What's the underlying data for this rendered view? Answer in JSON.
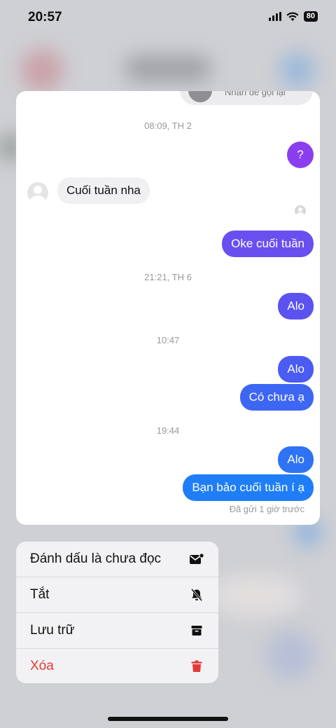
{
  "status_bar": {
    "time": "20:57",
    "battery": "80"
  },
  "conversation": {
    "top_pill_text": "Nhấn để gọi lại",
    "messages": [
      {
        "kind": "timestamp",
        "text": "08:09, TH 2"
      },
      {
        "kind": "sent",
        "text": "?",
        "color": "#8b3ef0"
      },
      {
        "kind": "received",
        "text": "Cuối tuần nha"
      },
      {
        "kind": "sent",
        "text": "Oke cuối tuần",
        "color": "#6a4ff0"
      },
      {
        "kind": "timestamp",
        "text": "21:21, TH 6"
      },
      {
        "kind": "sent",
        "text": "Alo",
        "color": "#5b52f0"
      },
      {
        "kind": "timestamp",
        "text": "10:47"
      },
      {
        "kind": "sent",
        "text": "Alo",
        "color": "#4a5cf2"
      },
      {
        "kind": "sent",
        "text": "Có chưa ạ",
        "color": "#3d66f3"
      },
      {
        "kind": "timestamp",
        "text": "19:44"
      },
      {
        "kind": "sent",
        "text": "Alo",
        "color": "#2f73f5"
      },
      {
        "kind": "sent",
        "text": "Bạn bảo cuối tuần í ạ",
        "color": "#1f7ef7"
      }
    ],
    "sent_status": "Đã gửi 1 giờ trước"
  },
  "context_menu": {
    "items": [
      {
        "label": "Đánh dấu là chưa đọc",
        "icon": "mark-unread-icon"
      },
      {
        "label": "Tắt",
        "icon": "mute-bell-icon"
      },
      {
        "label": "Lưu trữ",
        "icon": "archive-icon"
      },
      {
        "label": "Xóa",
        "icon": "trash-icon",
        "color": "#e53935"
      }
    ]
  }
}
